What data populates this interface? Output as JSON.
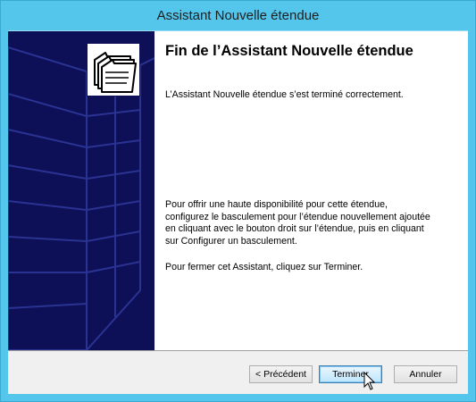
{
  "window": {
    "title": "Assistant Nouvelle étendue"
  },
  "content": {
    "heading": "Fin de l’Assistant Nouvelle étendue",
    "success_text": "L’Assistant Nouvelle étendue s’est terminé correctement.",
    "failover_text": "Pour offrir une haute disponibilité pour cette étendue, configurez le basculement pour l’étendue nouvellement ajoutée en cliquant avec le bouton droit sur l’étendue, puis en cliquant sur Configurer un basculement.",
    "close_text": "Pour fermer cet Assistant, cliquez sur Terminer."
  },
  "buttons": {
    "previous": "< Précédent",
    "finish": "Terminer",
    "cancel": "Annuler"
  },
  "colors": {
    "titlebar": "#54c6ec",
    "banner": "#0d0f57",
    "banner_lines": "#2a3392"
  },
  "icons": {
    "wizard": "folder-stack-icon",
    "cursor": "mouse-pointer-icon"
  }
}
